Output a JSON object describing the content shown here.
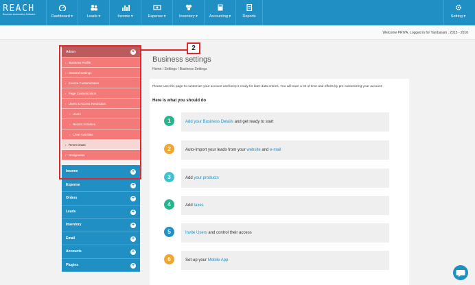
{
  "app": {
    "logo": "REACH",
    "logo_tagline": "Business Automation Software"
  },
  "nav": [
    {
      "label": "Dashboard ▾",
      "icon": "dashboard-icon"
    },
    {
      "label": "Leads ▾",
      "icon": "leads-icon"
    },
    {
      "label": "Income ▾",
      "icon": "income-chart-icon"
    },
    {
      "label": "Expense ▾",
      "icon": "expense-icon"
    },
    {
      "label": "Inventory ▾",
      "icon": "inventory-icon"
    },
    {
      "label": "Accounting ▾",
      "icon": "accounting-icon"
    },
    {
      "label": "Reports",
      "icon": "reports-icon"
    },
    {
      "label": "Setting ▾",
      "icon": "gear-icon"
    }
  ],
  "welcome": "Welcome PRIYA, Logged in for Tambaram . 2015 - 2016",
  "sidebar": {
    "admin": "Admin",
    "admin_items": [
      "Business Profile",
      "General Settings",
      "Invoice Customization",
      "Page Customization",
      "Users & Access Restriction"
    ],
    "user_items": [
      "Users",
      "Recent Activities",
      "Clear Activities"
    ],
    "active_item": "Reset Datas",
    "after_active": "Designation",
    "sections": [
      "Income",
      "Expense",
      "Orders",
      "Leads",
      "Inventory",
      "Email",
      "Accounts",
      "Plugins"
    ]
  },
  "callout": {
    "number": "2"
  },
  "page": {
    "title": "Business settings",
    "breadcrumb": "Home  /  Settings  /  Business Settings",
    "intro": "Please use this page to customize your account and keep it ready for later data entries. You will save a lot of time and efforts by pre customizing your account",
    "heading": "Here is what you should do"
  },
  "steps": [
    {
      "num": "1",
      "color": "#26b48e",
      "pre": "",
      "link": "Add your Business Details",
      "mid": " and get ready to start",
      "link2": "",
      "post": ""
    },
    {
      "num": "2",
      "color": "#f0a732",
      "pre": "Auto-Import your leads from your ",
      "link": "website",
      "mid": " and ",
      "link2": "e-mail",
      "post": ""
    },
    {
      "num": "3",
      "color": "#3ec2cf",
      "pre": "Add ",
      "link": "your products",
      "mid": "",
      "link2": "",
      "post": ""
    },
    {
      "num": "4",
      "color": "#26b48e",
      "pre": "Add ",
      "link": "taxes",
      "mid": "",
      "link2": "",
      "post": ""
    },
    {
      "num": "5",
      "color": "#1f8fc4",
      "pre": "",
      "link": "Invite Users",
      "mid": " and control their access",
      "link2": "",
      "post": ""
    },
    {
      "num": "6",
      "color": "#f0a732",
      "pre": "Set-up your ",
      "link": "Mobile App",
      "mid": "",
      "link2": "",
      "post": ""
    }
  ],
  "colors": {
    "brand": "#1f8fc4",
    "highlight": "#e0262b",
    "admin_header": "#bc5b5e",
    "admin_sub": "#f47a7a"
  }
}
